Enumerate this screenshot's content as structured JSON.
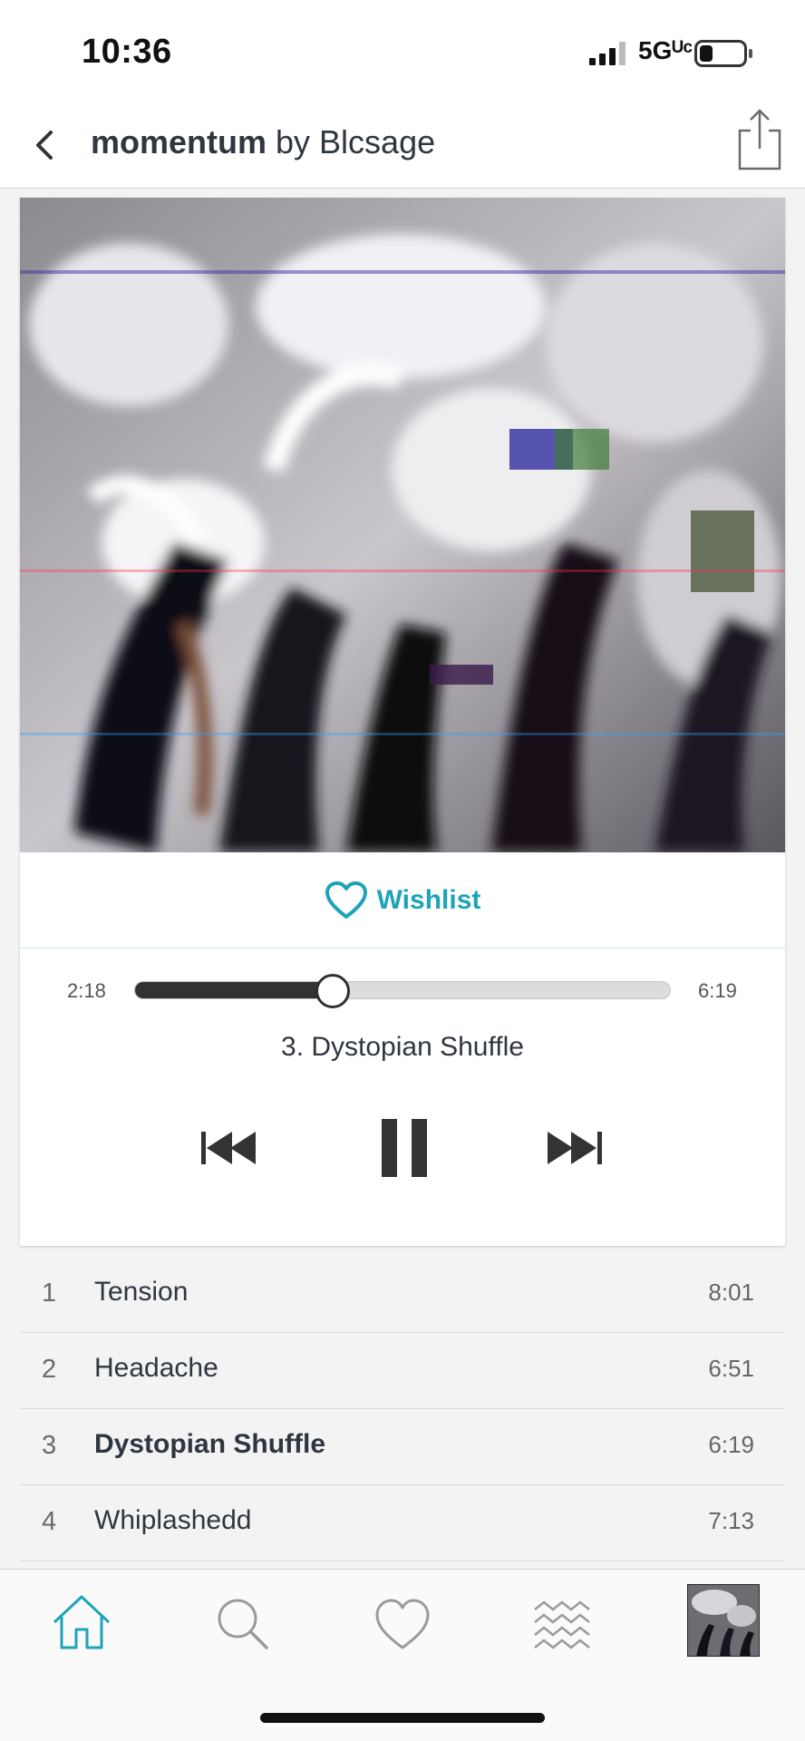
{
  "status_bar": {
    "time": "10:36",
    "network": "5Gᵁᶜ"
  },
  "header": {
    "album": "momentum",
    "by_artist": " by Blcsage"
  },
  "wishlist": {
    "label": "Wishlist",
    "accent_color": "#1fa3b8"
  },
  "player": {
    "elapsed": "2:18",
    "total": "6:19",
    "progress_fraction": 0.37,
    "now_playing": "3. Dystopian Shuffle"
  },
  "tracks": [
    {
      "num": "1",
      "title": "Tension",
      "duration": "8:01",
      "current": false
    },
    {
      "num": "2",
      "title": "Headache",
      "duration": "6:51",
      "current": false
    },
    {
      "num": "3",
      "title": "Dystopian Shuffle",
      "duration": "6:19",
      "current": true
    },
    {
      "num": "4",
      "title": "Whiplashedd",
      "duration": "7:13",
      "current": false
    }
  ],
  "tab_bar": {
    "icons": [
      "home-icon",
      "search-icon",
      "heart-icon",
      "waves-icon",
      "now-playing-thumbnail"
    ],
    "active_color": "#1fa3b8",
    "inactive_color": "#9a9a9a"
  }
}
